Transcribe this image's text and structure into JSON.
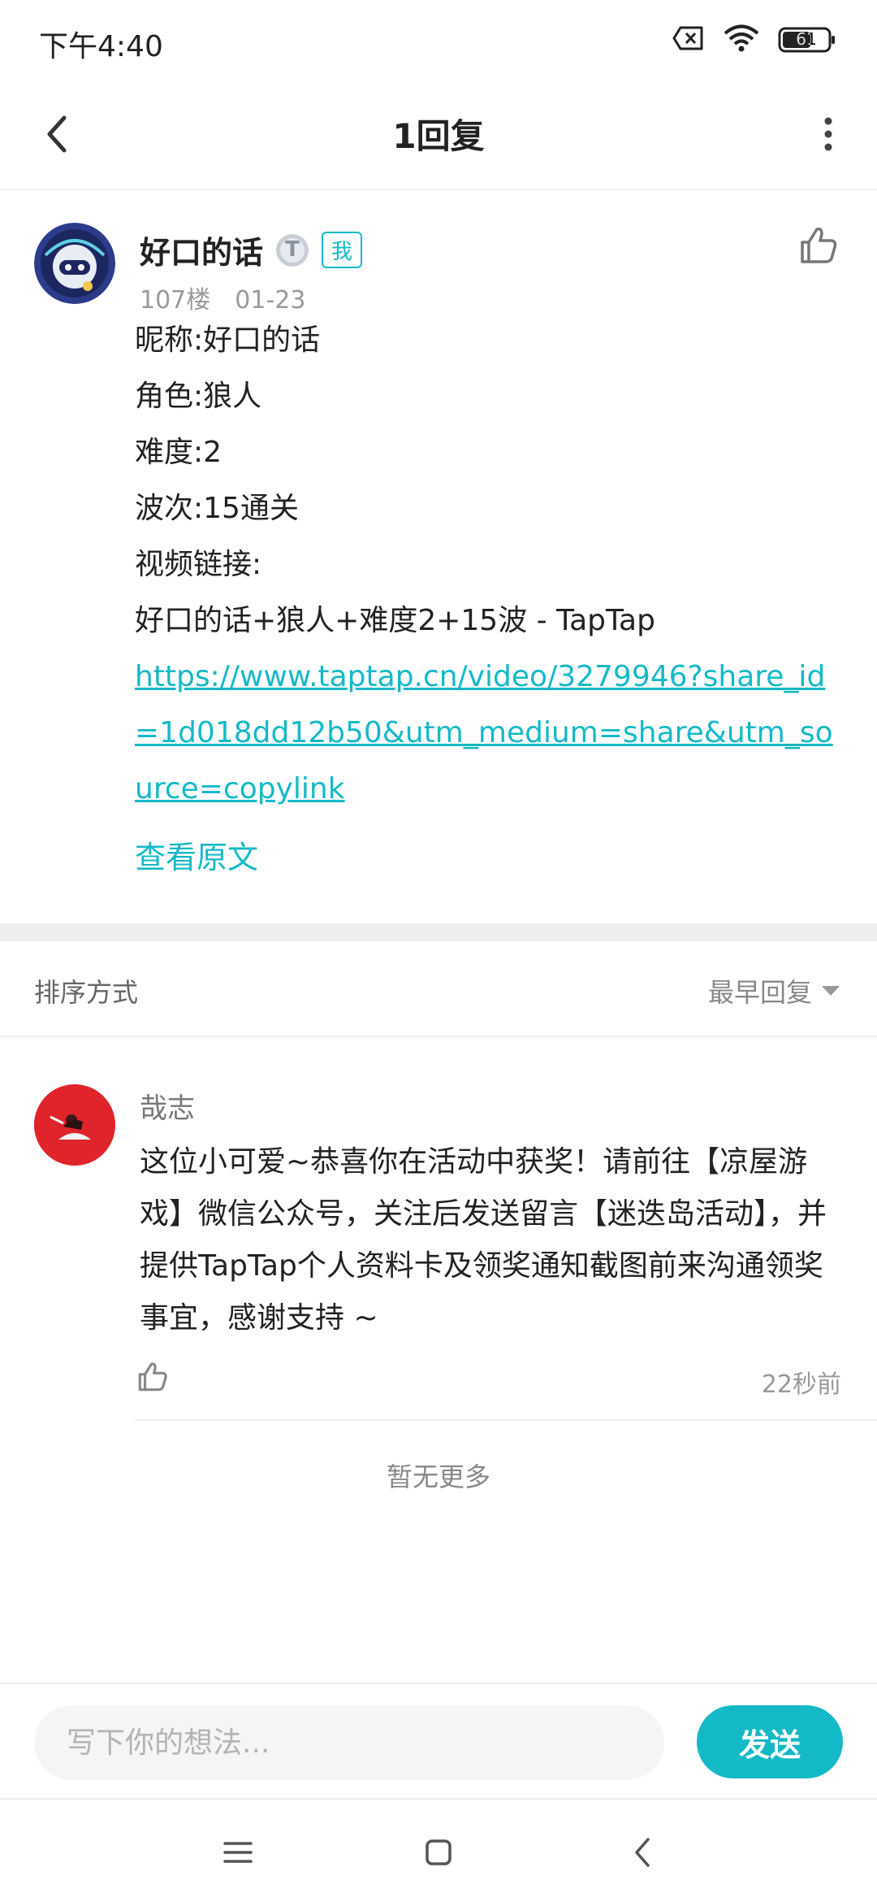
{
  "status_bar": {
    "time": "下午4:40",
    "battery": "61",
    "icons": [
      "sim-off-icon",
      "wifi-icon",
      "battery-icon"
    ]
  },
  "header": {
    "title": "1回复",
    "back_icon": "chevron-left-icon",
    "more_icon": "more-vertical-icon"
  },
  "post": {
    "author": "好口的话",
    "level_badge": "T",
    "me_badge": "我",
    "floor": "107楼",
    "date": "01-23",
    "lines": [
      "昵称:好口的话",
      "角色:狼人",
      "难度:2",
      "波次:15通关",
      "视频链接:",
      "好口的话+狼人+难度2+15波 - TapTap"
    ],
    "link": "https://www.taptap.cn/video/3279946?share_id=1d018dd12b50&utm_medium=share&utm_source=copylink",
    "view_original": "查看原文"
  },
  "sort": {
    "label": "排序方式",
    "selected": "最早回复"
  },
  "reply": {
    "author": "哉志",
    "text": "这位小可爱~恭喜你在活动中获奖！请前往【凉屋游戏】微信公众号，关注后发送留言【迷迭岛活动】，并提供TapTap个人资料卡及领奖通知截图前来沟通领奖事宜，感谢支持 ~",
    "time": "22秒前"
  },
  "no_more": "暂无更多",
  "comment_bar": {
    "placeholder": "写下你的想法...",
    "send_label": "发送"
  },
  "colors": {
    "accent": "#14b9c8",
    "divider": "#eeeeee"
  }
}
